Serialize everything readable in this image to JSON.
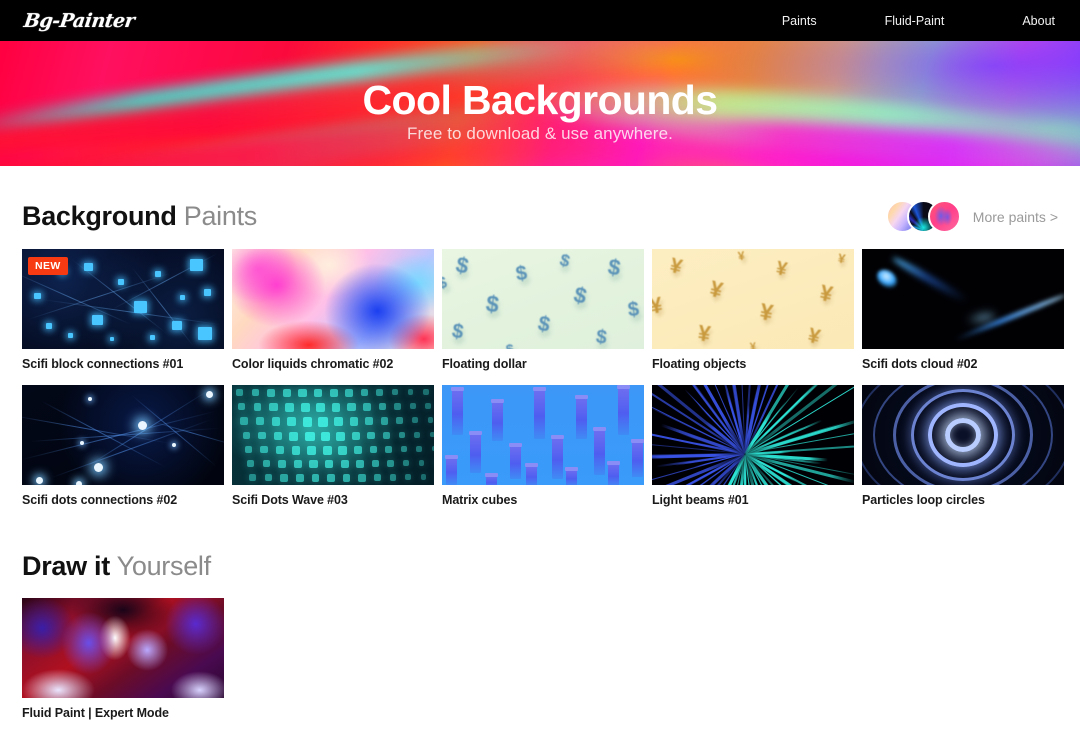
{
  "navbar": {
    "logo": "Bg-Painter",
    "links": [
      {
        "label": "Paints"
      },
      {
        "label": "Fluid-Paint"
      },
      {
        "label": "About"
      }
    ]
  },
  "hero": {
    "title": "Cool Backgrounds",
    "subtitle": "Free to download & use anywhere."
  },
  "sections": [
    {
      "title_bold": "Background",
      "title_light": "Paints",
      "more_label": "More paints >",
      "cards": [
        {
          "label": "Scifi block connections #01",
          "badge": "NEW"
        },
        {
          "label": "Color liquids chromatic #02"
        },
        {
          "label": "Floating dollar",
          "symbol": "$"
        },
        {
          "label": "Floating objects",
          "symbol": "¥"
        },
        {
          "label": "Scifi dots cloud #02"
        },
        {
          "label": "Scifi dots connections #02"
        },
        {
          "label": "Scifi Dots Wave #03"
        },
        {
          "label": "Matrix cubes"
        },
        {
          "label": "Light beams #01"
        },
        {
          "label": "Particles loop circles"
        }
      ]
    },
    {
      "title_bold": "Draw it",
      "title_light": "Yourself",
      "cards": [
        {
          "label": "Fluid Paint | Expert Mode"
        }
      ]
    }
  ],
  "colors": {
    "badge_bg": "#f83a12",
    "navbar_bg": "#000000",
    "title_bold": "#111111",
    "title_light": "#8b8b8b"
  }
}
